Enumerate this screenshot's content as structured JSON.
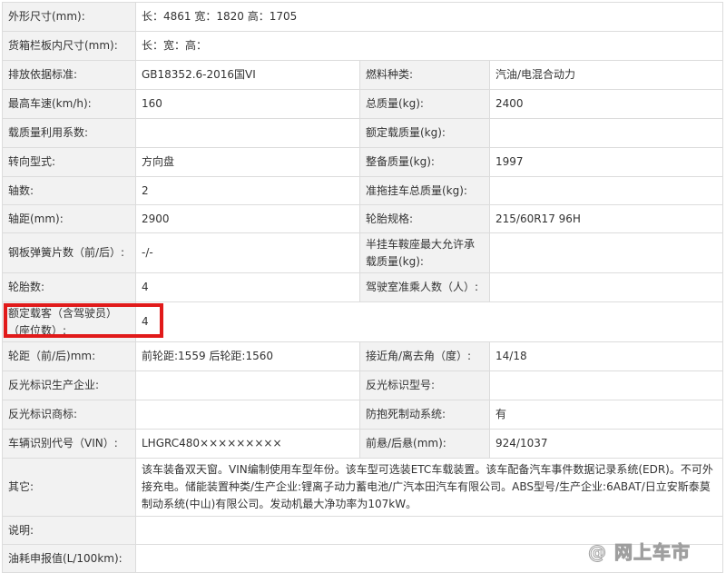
{
  "rows": [
    {
      "label": "外形尺寸(mm):",
      "value": "长：4861 宽：1820 高：1705"
    },
    {
      "label": "货箱栏板内尺寸(mm):",
      "value": "长：宽：高："
    },
    {
      "label": "排放依据标准:",
      "value": "GB18352.6-2016国VI",
      "label2": "燃料种类:",
      "value2": "汽油/电混合动力"
    },
    {
      "label": "最高车速(km/h):",
      "value": "160",
      "label2": "总质量(kg):",
      "value2": "2400"
    },
    {
      "label": "载质量利用系数:",
      "value": "",
      "label2": "额定载质量(kg):",
      "value2": ""
    },
    {
      "label": "转向型式:",
      "value": "方向盘",
      "label2": "整备质量(kg):",
      "value2": "1997"
    },
    {
      "label": "轴数:",
      "value": "2",
      "label2": "准拖挂车总质量(kg):",
      "value2": ""
    },
    {
      "label": "轴距(mm):",
      "value": "2900",
      "label2": "轮胎规格:",
      "value2": "215/60R17 96H"
    },
    {
      "label": "钢板弹簧片数（前/后）:",
      "value": "-/-",
      "label2": "半挂车鞍座最大允许承载质量(kg):",
      "value2": ""
    },
    {
      "label": "轮胎数:",
      "value": "4",
      "label2": "驾驶室准乘人数（人）:",
      "value2": ""
    },
    {
      "label": "额定载客（含驾驶员）（座位数）:",
      "value": "4"
    },
    {
      "label": "轮距（前/后)mm:",
      "value": "前轮距:1559 后轮距:1560",
      "label2": "接近角/离去角（度）:",
      "value2": "14/18"
    },
    {
      "label": "反光标识生产企业:",
      "value": "",
      "label2": "反光标识型号:",
      "value2": ""
    },
    {
      "label": "反光标识商标:",
      "value": "",
      "label2": "防抱死制动系统:",
      "value2": "有"
    },
    {
      "label": "车辆识别代号（VIN）:",
      "value": "LHGRC480×××××××××",
      "label2": "前悬/后悬(mm):",
      "value2": "924/1037"
    },
    {
      "label": "其它:",
      "value": "该车装备双天窗。VIN编制使用车型年份。该车型可选装ETC车载装置。该车配备汽车事件数据记录系统(EDR)。不可外接充电。储能装置种类/生产企业:锂离子动力蓄电池/广汽本田汽车有限公司。ABS型号/生产企业:6ABAT/日立安斯泰莫制动系统(中山)有限公司。发动机最大净功率为107kW。"
    },
    {
      "label": "说明:",
      "value": ""
    },
    {
      "label": "油耗申报值(L/100km):",
      "value": ""
    }
  ],
  "watermark": "@ 网上车市",
  "highlight_color": "#e11a1a"
}
